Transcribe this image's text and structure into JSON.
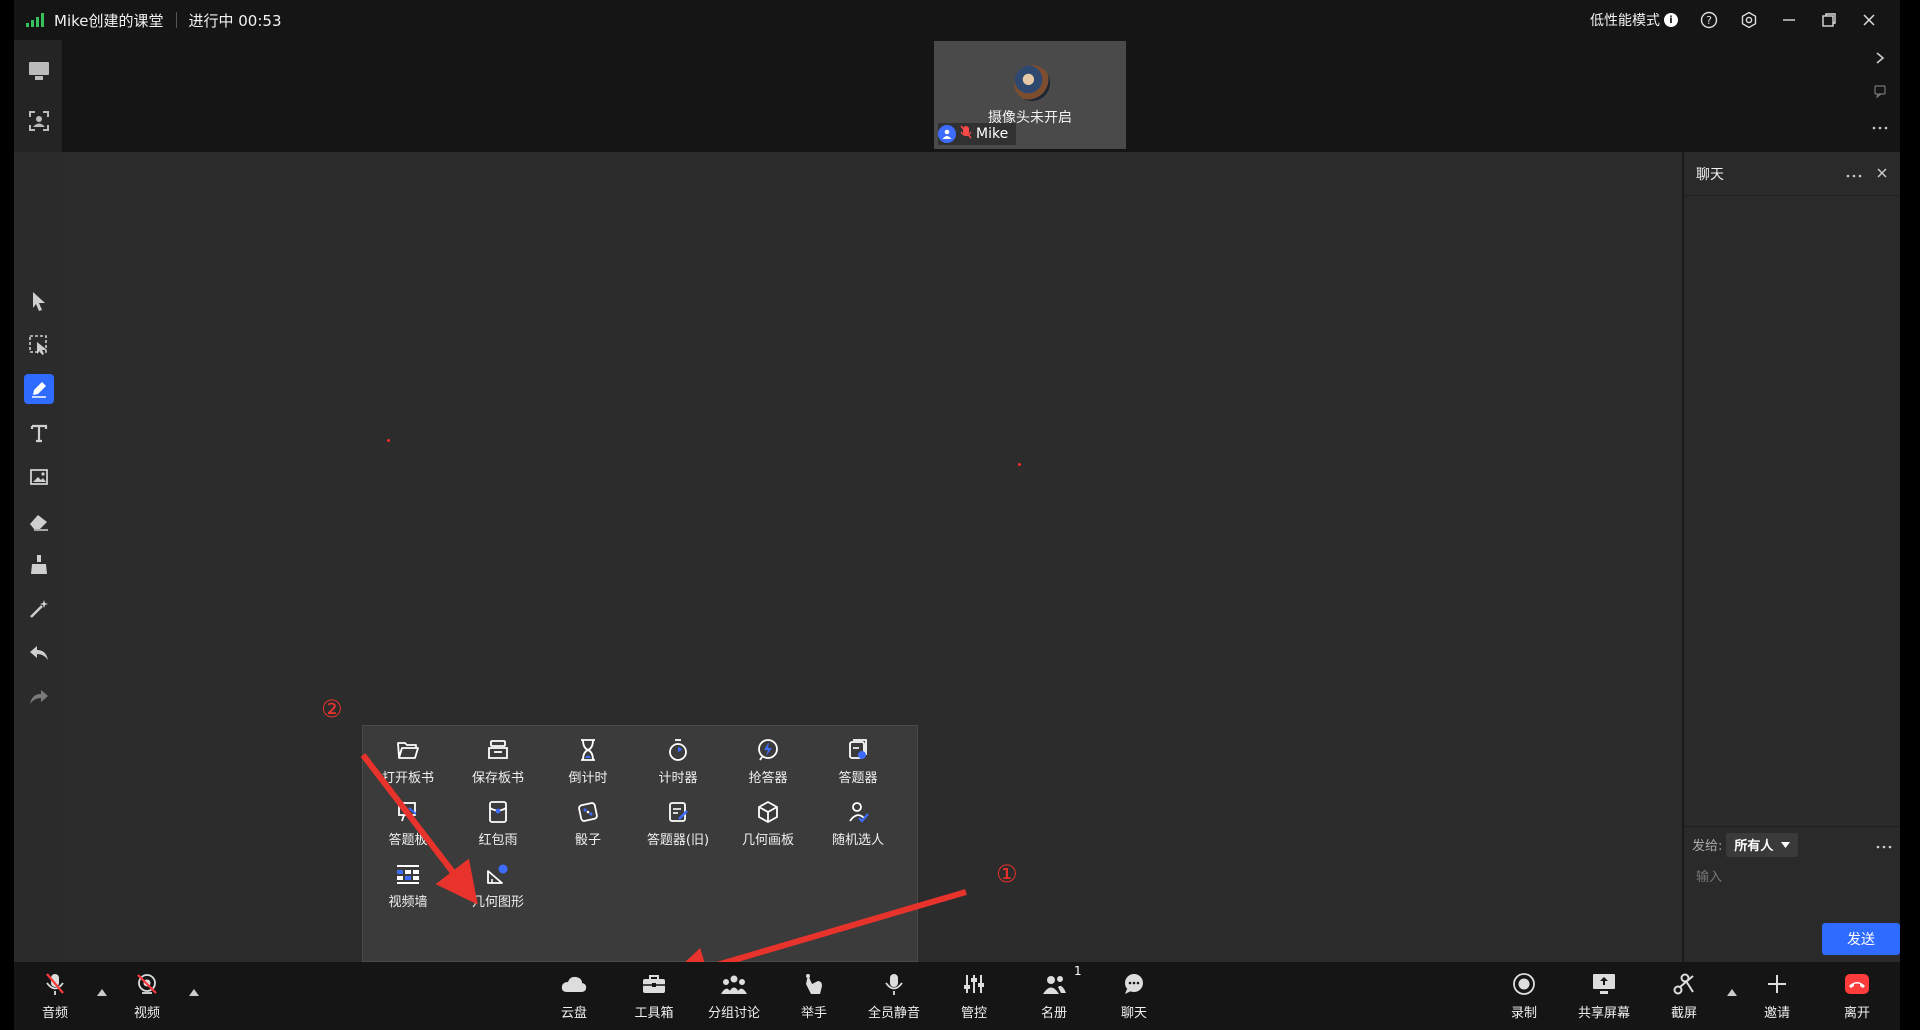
{
  "titlebar": {
    "classroom_name": "Mike创建的课堂",
    "status": "进行中 00:53",
    "low_perf_mode": "低性能模式"
  },
  "video": {
    "camera_off_text": "摄像头未开启",
    "participant_name": "Mike"
  },
  "chat": {
    "title": "聊天",
    "send_to_label": "发给:",
    "send_to_value": "所有人",
    "input_placeholder": "输入",
    "send_button": "发送"
  },
  "toolbox": {
    "items": [
      {
        "label": "打开板书",
        "icon": "folder-open-icon"
      },
      {
        "label": "保存板书",
        "icon": "save-board-icon"
      },
      {
        "label": "倒计时",
        "icon": "hourglass-icon"
      },
      {
        "label": "计时器",
        "icon": "stopwatch-icon"
      },
      {
        "label": "抢答器",
        "icon": "buzzer-icon"
      },
      {
        "label": "答题器",
        "icon": "quiz-icon"
      },
      {
        "label": "答题板",
        "icon": "answer-board-icon"
      },
      {
        "label": "红包雨",
        "icon": "red-envelope-icon"
      },
      {
        "label": "骰子",
        "icon": "dice-icon"
      },
      {
        "label": "答题器(旧)",
        "icon": "quiz-old-icon"
      },
      {
        "label": "几何画板",
        "icon": "cube-icon"
      },
      {
        "label": "随机选人",
        "icon": "random-person-icon"
      },
      {
        "label": "视频墙",
        "icon": "video-wall-icon"
      },
      {
        "label": "几何图形",
        "icon": "geometry-shape-icon"
      }
    ]
  },
  "annotations": {
    "marker_1": "①",
    "marker_2": "②",
    "color": "#e8322c"
  },
  "bottombar": {
    "audio": "音频",
    "video": "视频",
    "cloud": "云盘",
    "toolbox": "工具箱",
    "breakout": "分组讨论",
    "raise_hand": "举手",
    "mute_all": "全员静音",
    "control": "管控",
    "roster": "名册",
    "roster_count": "1",
    "chat": "聊天",
    "record": "录制",
    "share_screen": "共享屏幕",
    "screenshot": "截屏",
    "invite": "邀请",
    "leave": "离开"
  },
  "colors": {
    "accent": "#2f6bff",
    "signal": "#36c25b",
    "leave": "#ff3b3b"
  }
}
